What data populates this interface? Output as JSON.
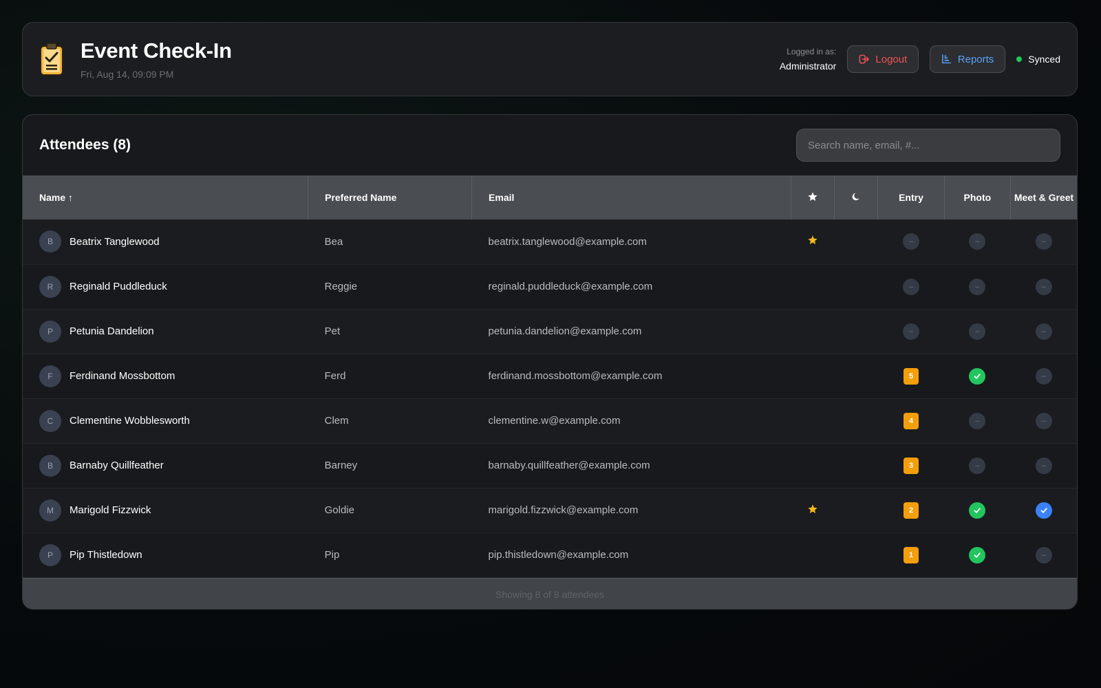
{
  "header": {
    "title": "Event Check-In",
    "datetime": "Fri, Aug 14, 09:09 PM",
    "logged_in_label": "Logged in as:",
    "logged_in_user": "Administrator",
    "logout_label": "Logout",
    "reports_label": "Reports",
    "sync_status": "Synced",
    "sync_color": "#22c55e",
    "logo_icon": "clipboard-check-icon"
  },
  "attendees": {
    "title": "Attendees (8)",
    "search_placeholder": "Search name, email, #...",
    "columns": {
      "name": "Name ↑",
      "preferred": "Preferred Name",
      "email": "Email",
      "vip": "star-icon",
      "night": "moon-icon",
      "entry": "Entry",
      "photo": "Photo",
      "meet": "Meet & Greet"
    },
    "rows": [
      {
        "initial": "B",
        "name": "Beatrix Tanglewood",
        "preferred": "Bea",
        "email": "beatrix.tanglewood@example.com",
        "vip": true,
        "entry": "–",
        "photo": "–",
        "meet": "–"
      },
      {
        "initial": "R",
        "name": "Reginald Puddleduck",
        "preferred": "Reggie",
        "email": "reginald.puddleduck@example.com",
        "vip": false,
        "entry": "–",
        "photo": "–",
        "meet": "–"
      },
      {
        "initial": "P",
        "name": "Petunia Dandelion",
        "preferred": "Pet",
        "email": "petunia.dandelion@example.com",
        "vip": false,
        "entry": "–",
        "photo": "–",
        "meet": "–"
      },
      {
        "initial": "F",
        "name": "Ferdinand Mossbottom",
        "preferred": "Ferd",
        "email": "ferdinand.mossbottom@example.com",
        "vip": false,
        "entry": "5",
        "photo": "check",
        "meet": "–"
      },
      {
        "initial": "C",
        "name": "Clementine Wobblesworth",
        "preferred": "Clem",
        "email": "clementine.w@example.com",
        "vip": false,
        "entry": "4",
        "photo": "–",
        "meet": "–"
      },
      {
        "initial": "B",
        "name": "Barnaby Quillfeather",
        "preferred": "Barney",
        "email": "barnaby.quillfeather@example.com",
        "vip": false,
        "entry": "3",
        "photo": "–",
        "meet": "–"
      },
      {
        "initial": "M",
        "name": "Marigold Fizzwick",
        "preferred": "Goldie",
        "email": "marigold.fizzwick@example.com",
        "vip": true,
        "entry": "2",
        "photo": "check",
        "meet": "check"
      },
      {
        "initial": "P",
        "name": "Pip Thistledown",
        "preferred": "Pip",
        "email": "pip.thistledown@example.com",
        "vip": false,
        "entry": "1",
        "photo": "check",
        "meet": "–"
      }
    ],
    "footer": "Showing 8 of 8 attendees"
  },
  "colors": {
    "accent_red": "#f05252",
    "accent_blue": "#5aa2f5",
    "entry_orange": "#f59e0b",
    "check_green": "#22c55e",
    "check_blue": "#3b82f6",
    "star_gold": "#f5b81c"
  }
}
